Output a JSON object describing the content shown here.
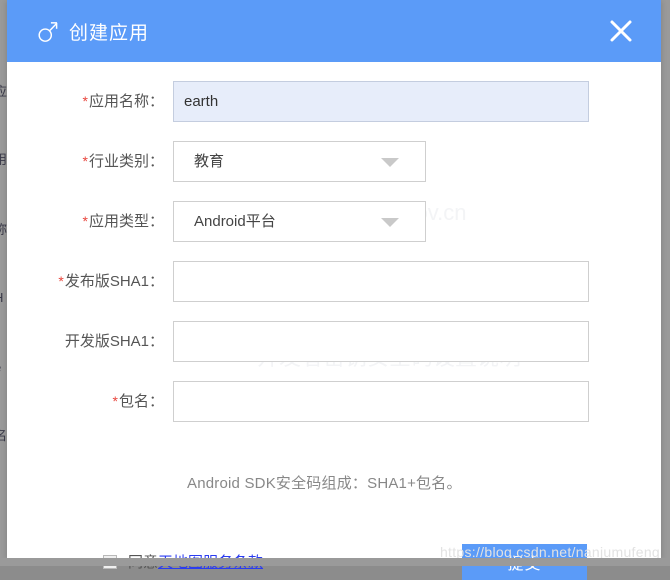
{
  "window": {
    "background_color": "#8c8c8c",
    "page_background_color": "#ffffff"
  },
  "background_page": {
    "ghost_fragments": [
      "应",
      "用",
      "称",
      "H",
      "e",
      "名"
    ]
  },
  "modal": {
    "header": {
      "icon": "mars-symbol-icon",
      "title": "创建应用",
      "close_label": "✕",
      "background_color": "#5b9bf8",
      "text_color": "#ffffff"
    },
    "required_marker": "*",
    "fields": [
      {
        "id": "app-name",
        "required": true,
        "label": "应用名称：",
        "type": "text",
        "value": "earth",
        "placeholder": "",
        "autofilled": true
      },
      {
        "id": "industry-category",
        "required": true,
        "label": "行业类别：",
        "type": "select",
        "value": "教育"
      },
      {
        "id": "app-type",
        "required": true,
        "label": "应用类型：",
        "type": "select",
        "value": "Android平台"
      },
      {
        "id": "release-sha1",
        "required": true,
        "label": "发布版SHA1：",
        "type": "text",
        "value": "",
        "placeholder": ""
      },
      {
        "id": "develop-sha1",
        "required": false,
        "label": "开发版SHA1：",
        "type": "text",
        "value": "",
        "placeholder": ""
      },
      {
        "id": "package-name",
        "required": true,
        "label": "包名：",
        "type": "text",
        "value": "",
        "placeholder": ""
      }
    ],
    "hint": "Android SDK安全码组成：SHA1+包名。",
    "footer": {
      "agree_prefix": "同意",
      "terms_link": "天地图服务条款",
      "terms_link_color": "#2b3cf0",
      "checkbox_checked": false,
      "submit_label": "提交",
      "submit_color": "#5b9bf8"
    }
  },
  "watermark": "https://blog.csdn.net/nanjumufeng"
}
